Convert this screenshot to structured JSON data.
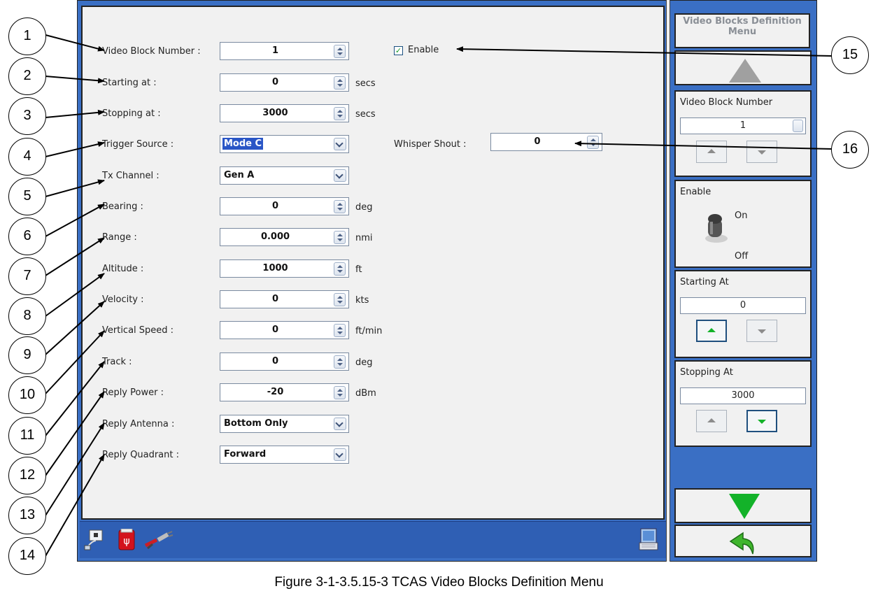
{
  "form": {
    "fields": [
      {
        "label": "Video Block Number :",
        "value": "1",
        "unit": ""
      },
      {
        "label": "Starting at :",
        "value": "0",
        "unit": "secs"
      },
      {
        "label": "Stopping at :",
        "value": "3000",
        "unit": "secs"
      },
      {
        "label": "Trigger Source :",
        "value": "Mode C",
        "unit": ""
      },
      {
        "label": "Tx Channel :",
        "value": "Gen A",
        "unit": ""
      },
      {
        "label": "Bearing :",
        "value": "0",
        "unit": "deg"
      },
      {
        "label": "Range :",
        "value": "0.000",
        "unit": "nmi"
      },
      {
        "label": "Altitude :",
        "value": "1000",
        "unit": "ft"
      },
      {
        "label": "Velocity :",
        "value": "0",
        "unit": "kts"
      },
      {
        "label": "Vertical Speed :",
        "value": "0",
        "unit": "ft/min"
      },
      {
        "label": "Track :",
        "value": "0",
        "unit": "deg"
      },
      {
        "label": "Reply Power :",
        "value": "-20",
        "unit": "dBm"
      },
      {
        "label": "Reply Antenna :",
        "value": "Bottom Only",
        "unit": ""
      },
      {
        "label": "Reply Quadrant :",
        "value": "Forward",
        "unit": ""
      }
    ],
    "enable": {
      "label": "Enable",
      "checked": true
    },
    "whisper_shout": {
      "label": "Whisper Shout  :",
      "value": "0"
    }
  },
  "right_panel": {
    "title": "Video Blocks Definition Menu",
    "video_block_number": {
      "label": "Video Block Number",
      "value": "1"
    },
    "enable": {
      "label": "Enable",
      "on": "On",
      "off": "Off"
    },
    "starting_at": {
      "label": "Starting At",
      "value": "0"
    },
    "stopping_at": {
      "label": "Stopping At",
      "value": "3000"
    }
  },
  "callouts": [
    "1",
    "2",
    "3",
    "4",
    "5",
    "6",
    "7",
    "8",
    "9",
    "10",
    "11",
    "12",
    "13",
    "14",
    "15",
    "16"
  ],
  "caption": "Figure 3-1-3.5.15-3 TCAS Video Blocks Definition Menu",
  "colors": {
    "accent": "#3a6fc4",
    "green": "#13b229"
  },
  "icons": [
    "network-icon",
    "usb-icon",
    "plug-icon",
    "keyboard-icon",
    "up-arrow-icon",
    "down-arrow-icon",
    "back-arrow-icon",
    "toggle-switch-icon"
  ]
}
